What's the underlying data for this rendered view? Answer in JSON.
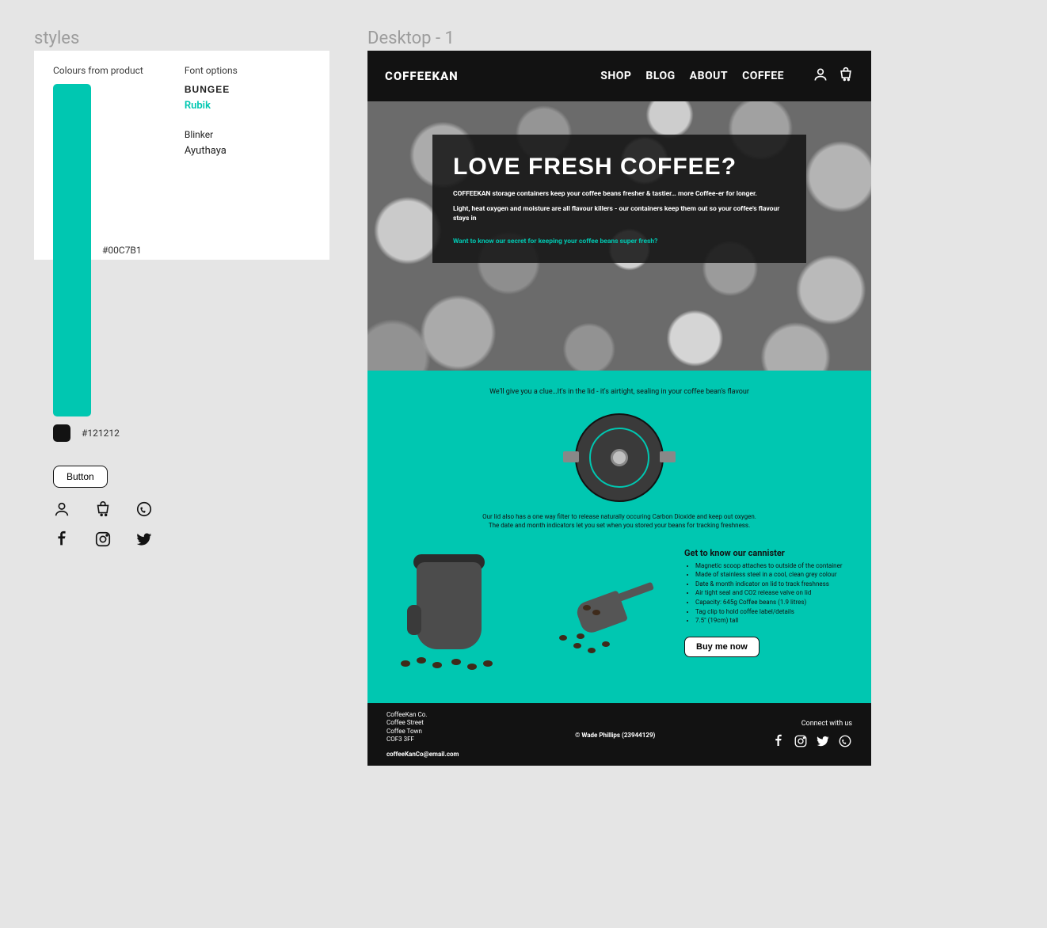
{
  "frameLabels": {
    "styles": "styles",
    "desktop": "Desktop - 1"
  },
  "stylesPanel": {
    "heading_colours": "Colours from product",
    "heading_fonts": "Font options",
    "swatches": [
      {
        "hex": "#00C7B1"
      },
      {
        "hex": "#121212"
      }
    ],
    "fonts": {
      "bungee": "BUNGEE",
      "rubik": "Rubik",
      "blinker": "Blinker",
      "ayuthaya": "Ayuthaya"
    },
    "button_label": "Button"
  },
  "header": {
    "logo": "COFFEEKAN",
    "nav": [
      "SHOP",
      "BLOG",
      "ABOUT",
      "COFFEE"
    ]
  },
  "hero": {
    "title": "LOVE FRESH COFFEE?",
    "p1": "COFFEEKAN storage containers keep your coffee beans fresher & tastier… more Coffee-er for longer.",
    "p2": "Light, heat oxygen and moisture are all flavour killers - our containers keep them out so your coffee's flavour stays in",
    "link": "Want to know our secret for keeping your coffee beans super fresh?"
  },
  "teal": {
    "intro": "We'll give you a clue…It's in the lid - it's airtight, sealing in your coffee bean's flavour",
    "desc1": "Our lid also has a one way filter to release naturally occuring Carbon Dioxide and keep out oxygen.",
    "desc2": "The date and month indicators let you set when you stored your beans for tracking freshness.",
    "features_title": "Get to know our cannister",
    "features": [
      "Magnetic scoop attaches to outside of the container",
      "Made of stainless steel in a cool, clean grey colour",
      "Date & month indicator on lid to track freshness",
      "Air tight seal and CO2 release valve on lid",
      "Capacity: 645g Coffee beans (1.9 litres)",
      "Tag clip to hold coffee label/details",
      "7.5\" (19cm) tall"
    ],
    "buy_label": "Buy me now"
  },
  "footer": {
    "addr1": "CoffeeKan Co.",
    "addr2": "Coffee Street",
    "addr3": "Coffee Town",
    "addr4": "COF3 3FF",
    "email": "coffeeKanCo@email.com",
    "copyright": "© Wade Phillips (23944129)",
    "connect": "Connect with us"
  }
}
